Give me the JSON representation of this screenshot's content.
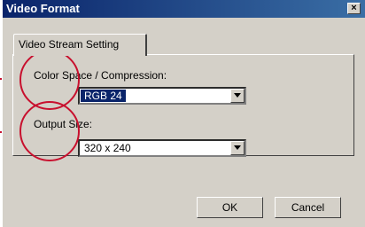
{
  "window": {
    "title": "Video Format",
    "close_glyph": "×"
  },
  "tab": {
    "label": "Video Stream Setting"
  },
  "color_space": {
    "label": "Color Space / Compression:",
    "value": "RGB 24"
  },
  "output_size": {
    "label": "Output Size:",
    "value": "320 x 240"
  },
  "buttons": {
    "ok": "OK",
    "cancel": "Cancel"
  },
  "colors": {
    "titlebar": "#0a246a",
    "highlight_circle": "#c8102e",
    "dialog_face": "#d4d0c8"
  }
}
